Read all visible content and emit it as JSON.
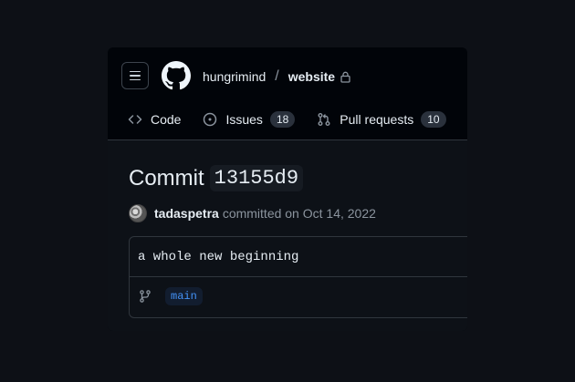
{
  "header": {
    "owner": "hungrimind",
    "separator": "/",
    "repo": "website"
  },
  "tabs": [
    {
      "label": "Code",
      "icon": "code-icon"
    },
    {
      "label": "Issues",
      "icon": "issue-opened-icon",
      "count": "18"
    },
    {
      "label": "Pull requests",
      "icon": "git-pull-request-icon",
      "count": "10"
    }
  ],
  "commit": {
    "title_prefix": "Commit",
    "sha": "13155d9",
    "author": "tadaspetra",
    "action": "committed on Oct 14, 2022",
    "message": "a whole new beginning",
    "branch": "main"
  },
  "colors": {
    "background": "#0d1016",
    "accent_link": "#4493f8",
    "muted_text": "#8b949e"
  }
}
